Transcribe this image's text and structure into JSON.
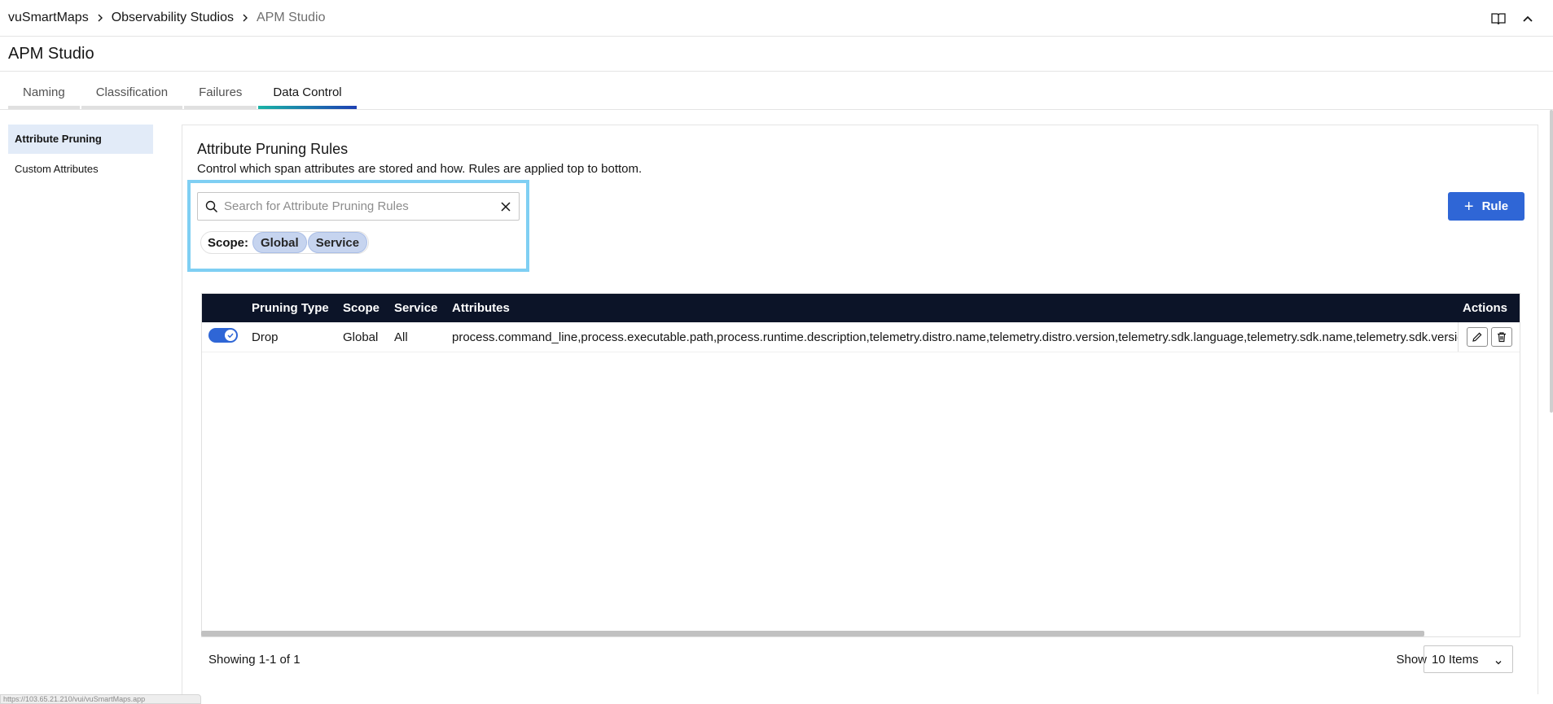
{
  "breadcrumb": {
    "items": [
      "vuSmartMaps",
      "Observability Studios",
      "APM Studio"
    ]
  },
  "header": {
    "title": "APM Studio"
  },
  "tabs": [
    {
      "label": "Naming"
    },
    {
      "label": "Classification"
    },
    {
      "label": "Failures"
    },
    {
      "label": "Data Control",
      "active": true
    }
  ],
  "sidebar": {
    "items": [
      {
        "label": "Attribute Pruning",
        "active": true
      },
      {
        "label": "Custom Attributes"
      }
    ]
  },
  "main": {
    "title": "Attribute Pruning Rules",
    "description": "Control which span attributes are stored and how. Rules are applied top to bottom.",
    "search": {
      "placeholder": "Search for Attribute Pruning Rules",
      "value": ""
    },
    "scope": {
      "label": "Scope:",
      "chips": [
        "Global",
        "Service"
      ]
    },
    "add_button": {
      "label": "Rule",
      "icon": "plus-icon"
    },
    "table": {
      "columns": [
        "",
        "Pruning Type",
        "Scope",
        "Service",
        "Attributes",
        "Actions"
      ],
      "rows": [
        {
          "enabled": true,
          "pruning_type": "Drop",
          "scope": "Global",
          "service": "All",
          "attributes": "process.command_line,process.executable.path,process.runtime.description,telemetry.distro.name,telemetry.distro.version,telemetry.sdk.language,telemetry.sdk.name,telemetry.sdk.version"
        }
      ]
    },
    "footer": {
      "showing": "Showing 1-1 of 1",
      "show_label": "Show",
      "page_size": "10 Items"
    }
  },
  "status_bar": {
    "url": "https://103.65.21.210/vui/vuSmartMaps.app"
  },
  "colors": {
    "accent": "#2f66d6",
    "table_header": "#0c1428",
    "chip": "#c6d4ef",
    "highlight": "#7fcff3",
    "nav_active": "#e2ebf8"
  }
}
